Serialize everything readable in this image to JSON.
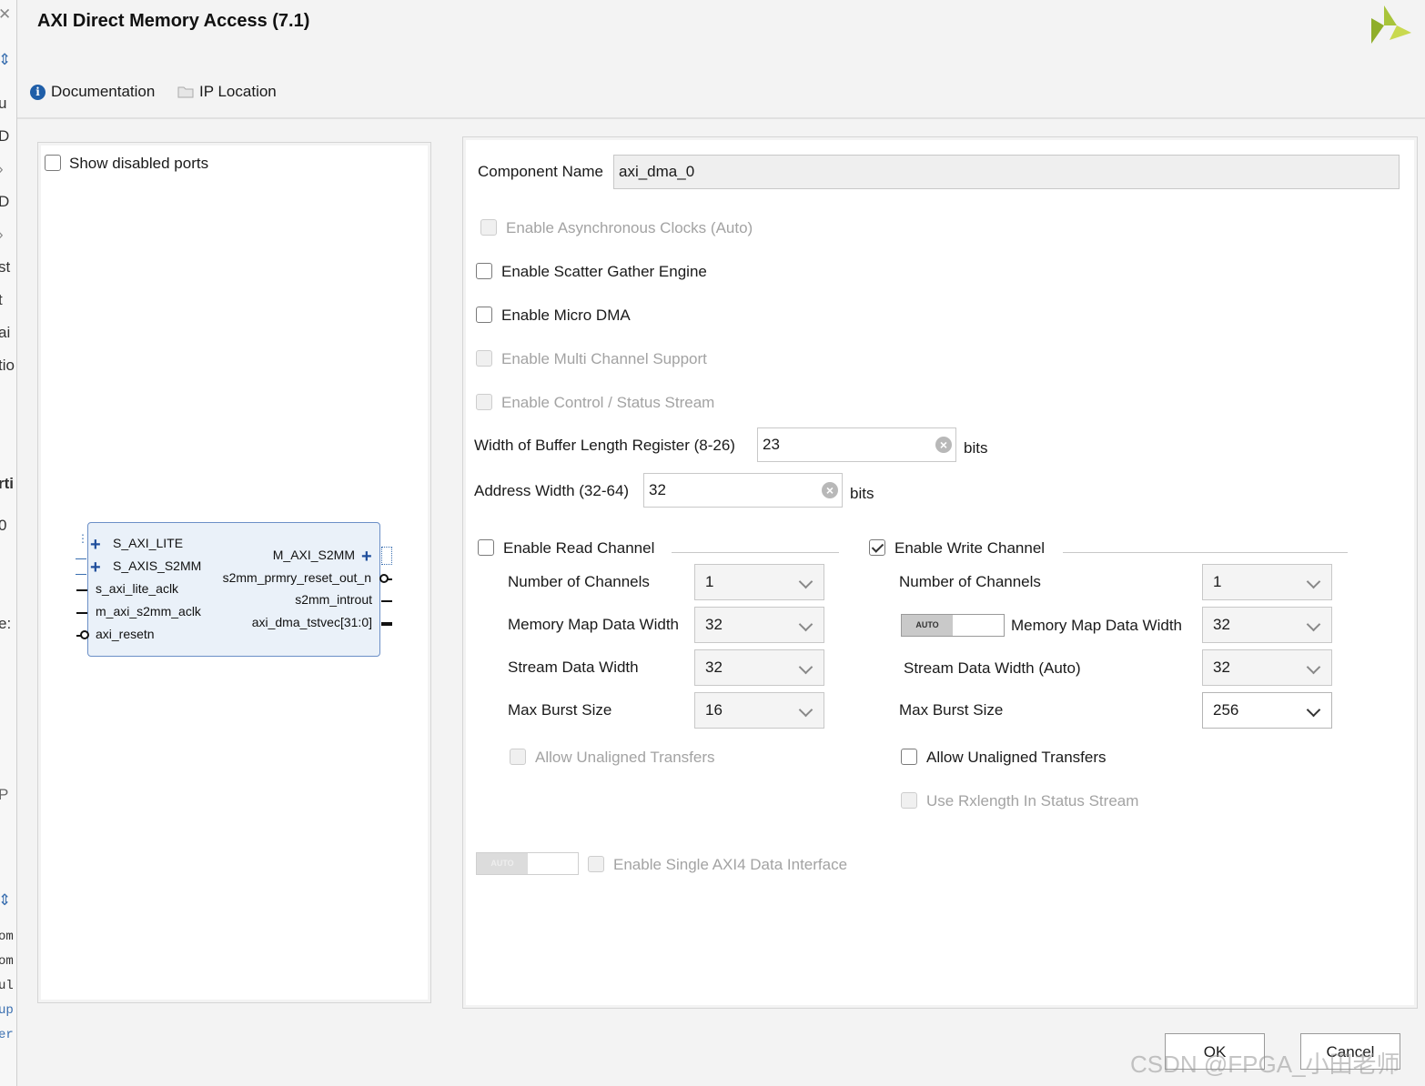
{
  "left_strip": {
    "fragments": [
      "u",
      "D",
      "D",
      "st",
      "t",
      "ai",
      "tio",
      "rti",
      "0",
      "e:",
      "P"
    ],
    "code_fragments": [
      "om",
      "om",
      "ul",
      "up",
      "er"
    ]
  },
  "header": {
    "title": "AXI Direct Memory Access (7.1)",
    "documentation_label": "Documentation",
    "ip_location_label": "IP Location"
  },
  "symbol_panel": {
    "show_disabled_ports_label": "Show disabled ports",
    "show_disabled_ports_checked": false,
    "block": {
      "left_ports": [
        "S_AXI_LITE",
        "S_AXIS_S2MM",
        "s_axi_lite_aclk",
        "m_axi_s2mm_aclk",
        "axi_resetn"
      ],
      "right_ports": [
        "M_AXI_S2MM",
        "s2mm_prmry_reset_out_n",
        "s2mm_introut",
        "axi_dma_tstvec[31:0]"
      ]
    }
  },
  "config": {
    "component_name_label": "Component Name",
    "component_name_value": "axi_dma_0",
    "options": {
      "async_clocks": "Enable Asynchronous Clocks (Auto)",
      "scatter_gather": "Enable Scatter Gather Engine",
      "micro_dma": "Enable Micro DMA",
      "multi_channel": "Enable Multi Channel Support",
      "control_status": "Enable Control / Status Stream"
    },
    "buffer_length": {
      "label": "Width of Buffer Length Register (8-26)",
      "value": "23",
      "unit": "bits"
    },
    "address_width": {
      "label": "Address Width (32-64)",
      "value": "32",
      "unit": "bits"
    },
    "read_channel": {
      "label": "Enable Read Channel",
      "enabled": false,
      "num_channels_label": "Number of Channels",
      "num_channels": "1",
      "mm_width_label": "Memory Map Data Width",
      "mm_width": "32",
      "stream_width_label": "Stream Data Width",
      "stream_width": "32",
      "burst_label": "Max Burst Size",
      "burst": "16",
      "unaligned_label": "Allow Unaligned Transfers"
    },
    "write_channel": {
      "label": "Enable Write Channel",
      "enabled": true,
      "num_channels_label": "Number of Channels",
      "num_channels": "1",
      "auto_label": "AUTO",
      "mm_width_label": "Memory Map Data Width",
      "mm_width": "32",
      "stream_width_label": "Stream Data Width (Auto)",
      "stream_width": "32",
      "burst_label": "Max Burst Size",
      "burst": "256",
      "unaligned_label": "Allow Unaligned Transfers",
      "rxlength_label": "Use Rxlength In Status Stream"
    },
    "single_axi4": {
      "auto_label": "AUTO",
      "label": "Enable Single AXI4 Data Interface"
    }
  },
  "footer": {
    "ok_label": "OK",
    "cancel_label": "Cancel"
  },
  "watermark": "CSDN @FPGA_小田老师"
}
